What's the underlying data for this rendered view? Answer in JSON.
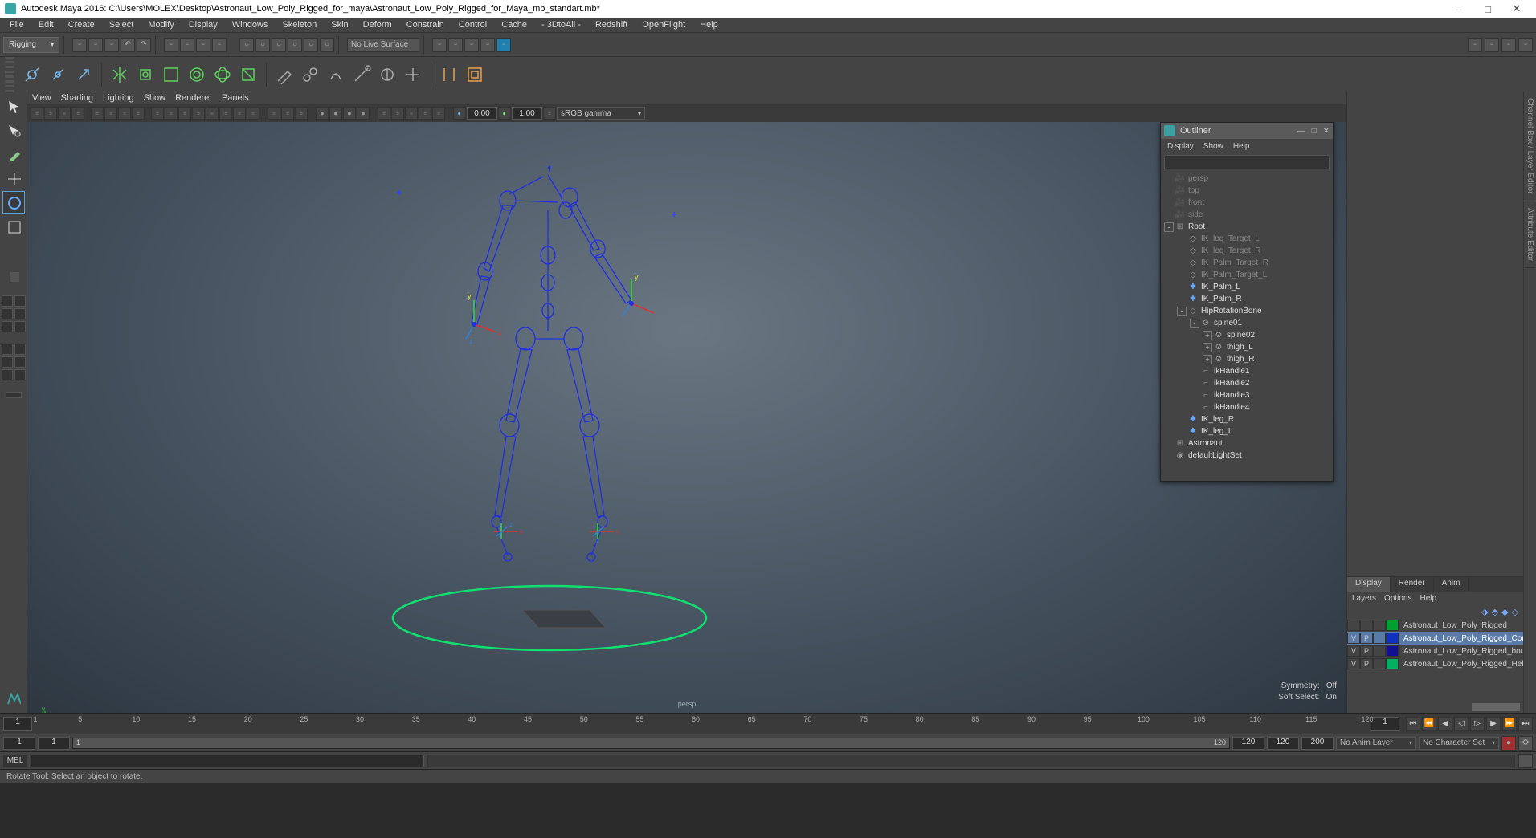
{
  "title": "Autodesk Maya 2016: C:\\Users\\MOLEX\\Desktop\\Astronaut_Low_Poly_Rigged_for_maya\\Astronaut_Low_Poly_Rigged_for_Maya_mb_standart.mb*",
  "menus": [
    "File",
    "Edit",
    "Create",
    "Select",
    "Modify",
    "Display",
    "Windows",
    "Skeleton",
    "Skin",
    "Deform",
    "Constrain",
    "Control",
    "Cache",
    "- 3DtoAll -",
    "Redshift",
    "OpenFlight",
    "Help"
  ],
  "workspace": "Rigging",
  "liveSurface": "No Live Surface",
  "panelMenus": [
    "View",
    "Shading",
    "Lighting",
    "Show",
    "Renderer",
    "Panels"
  ],
  "viewportGamma": "sRGB gamma",
  "exposure": "0.00",
  "gammaVal": "1.00",
  "hud": {
    "symmetry": "Symmetry:",
    "symVal": "Off",
    "softSel": "Soft Select:",
    "softVal": "On",
    "cam": "persp"
  },
  "outliner": {
    "title": "Outliner",
    "menus": [
      "Display",
      "Show",
      "Help"
    ],
    "items": [
      {
        "indent": 0,
        "exp": "",
        "icon": "cam",
        "label": "persp",
        "dim": true
      },
      {
        "indent": 0,
        "exp": "",
        "icon": "cam",
        "label": "top",
        "dim": true
      },
      {
        "indent": 0,
        "exp": "",
        "icon": "cam",
        "label": "front",
        "dim": true
      },
      {
        "indent": 0,
        "exp": "",
        "icon": "cam",
        "label": "side",
        "dim": true
      },
      {
        "indent": 0,
        "exp": "-",
        "icon": "grp",
        "label": "Root",
        "dim": false
      },
      {
        "indent": 1,
        "exp": "",
        "icon": "ctrl",
        "label": "IK_leg_Target_L",
        "dim": true
      },
      {
        "indent": 1,
        "exp": "",
        "icon": "ctrl",
        "label": "IK_leg_Target_R",
        "dim": true
      },
      {
        "indent": 1,
        "exp": "",
        "icon": "ctrl",
        "label": "IK_Palm_Target_R",
        "dim": true
      },
      {
        "indent": 1,
        "exp": "",
        "icon": "ctrl",
        "label": "IK_Palm_Target_L",
        "dim": true
      },
      {
        "indent": 1,
        "exp": "",
        "icon": "loc",
        "label": "IK_Palm_L",
        "dim": false
      },
      {
        "indent": 1,
        "exp": "",
        "icon": "loc",
        "label": "IK_Palm_R",
        "dim": false
      },
      {
        "indent": 1,
        "exp": "-",
        "icon": "ctrl",
        "label": "HipRotationBone",
        "dim": false
      },
      {
        "indent": 2,
        "exp": "-",
        "icon": "jnt",
        "label": "spine01",
        "dim": false
      },
      {
        "indent": 3,
        "exp": "+",
        "icon": "jnt",
        "label": "spine02",
        "dim": false
      },
      {
        "indent": 3,
        "exp": "+",
        "icon": "jnt",
        "label": "thigh_L",
        "dim": false
      },
      {
        "indent": 3,
        "exp": "+",
        "icon": "jnt",
        "label": "thigh_R",
        "dim": false
      },
      {
        "indent": 2,
        "exp": "",
        "icon": "ik",
        "label": "ikHandle1",
        "dim": false
      },
      {
        "indent": 2,
        "exp": "",
        "icon": "ik",
        "label": "ikHandle2",
        "dim": false
      },
      {
        "indent": 2,
        "exp": "",
        "icon": "ik",
        "label": "ikHandle3",
        "dim": false
      },
      {
        "indent": 2,
        "exp": "",
        "icon": "ik",
        "label": "ikHandle4",
        "dim": false
      },
      {
        "indent": 1,
        "exp": "",
        "icon": "loc",
        "label": "IK_leg_R",
        "dim": false
      },
      {
        "indent": 1,
        "exp": "",
        "icon": "loc",
        "label": "IK_leg_L",
        "dim": false
      },
      {
        "indent": 0,
        "exp": "",
        "icon": "grp",
        "label": "Astronaut",
        "dim": false
      },
      {
        "indent": 0,
        "exp": "",
        "icon": "set",
        "label": "defaultLightSet",
        "dim": false
      }
    ]
  },
  "layerTabs": [
    "Display",
    "Render",
    "Anim"
  ],
  "layerMenus": [
    "Layers",
    "Options",
    "Help"
  ],
  "layers": [
    {
      "v": "",
      "p": "",
      "r": "",
      "color": "#00a030",
      "name": "Astronaut_Low_Poly_Rigged",
      "sel": false
    },
    {
      "v": "V",
      "p": "P",
      "r": "",
      "color": "#1030c0",
      "name": "Astronaut_Low_Poly_Rigged_Contr",
      "sel": true
    },
    {
      "v": "V",
      "p": "P",
      "r": "",
      "color": "#101090",
      "name": "Astronaut_Low_Poly_Rigged_bones",
      "sel": false
    },
    {
      "v": "V",
      "p": "P",
      "r": "",
      "color": "#00b060",
      "name": "Astronaut_Low_Poly_Rigged_Helpe",
      "sel": false
    }
  ],
  "time": {
    "currentL": "1",
    "currentR": "1",
    "startOut": "1",
    "startIn": "1",
    "endIn": "120",
    "endOut": "120",
    "fps": "200",
    "ticks": [
      1,
      5,
      10,
      15,
      20,
      25,
      30,
      35,
      40,
      45,
      50,
      55,
      60,
      65,
      70,
      75,
      80,
      85,
      90,
      95,
      100,
      105,
      110,
      115,
      120
    ]
  },
  "animLayer": "No Anim Layer",
  "charSet": "No Character Set",
  "cmdLang": "MEL",
  "statusText": "Rotate Tool: Select an object to rotate.",
  "rightTabs": [
    "Channel Box / Layer Editor",
    "Attribute Editor"
  ]
}
